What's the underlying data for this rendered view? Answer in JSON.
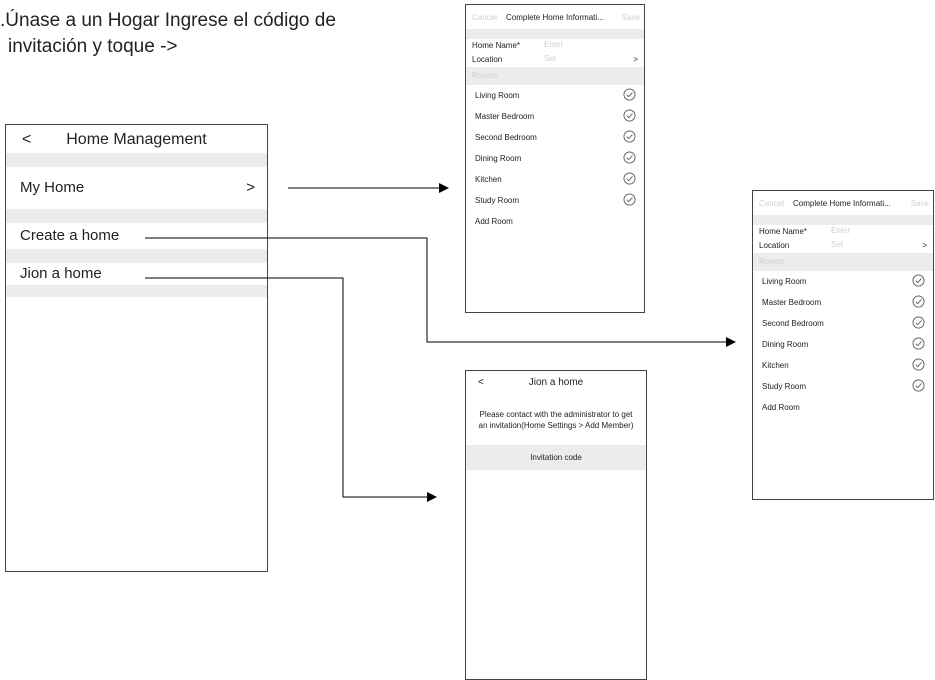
{
  "instruction": {
    "line1": ".Únase a un Hogar Ingrese el código de",
    "line2": "invitación y toque ->"
  },
  "home_management": {
    "back": "<",
    "title": "Home Management",
    "my_home": "My Home",
    "my_home_chevron": ">",
    "create_home": "Create a home",
    "join_home": "Jion a home"
  },
  "complete_info": {
    "cancel": "Cancel",
    "title": "Complete Home Informati...",
    "save": "Save",
    "home_name_label": "Home Name*",
    "home_name_placeholder": "Enter",
    "location_label": "Location",
    "location_value": "Set",
    "location_chevron": ">",
    "rooms_header": "Rooms:",
    "rooms": [
      "Living Room",
      "Master Bedroom",
      "Second Bedroom",
      "Dining Room",
      "Kitchen",
      "Study Room"
    ],
    "add_room": "Add Room"
  },
  "join_home": {
    "back": "<",
    "title": "Jion a home",
    "message": "Please contact with the administrator to get an invitation(Home Settings > Add Member)",
    "invitation_code": "Invitation code"
  }
}
